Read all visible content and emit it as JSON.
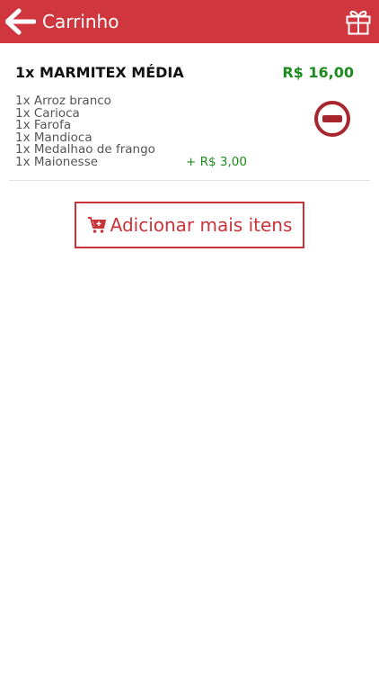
{
  "header": {
    "title": "Carrinho",
    "back_icon": "arrow-left-icon",
    "gift_icon": "gift-icon",
    "background_color": "#d0363d"
  },
  "cart": {
    "items": [
      {
        "title": "1x MARMITEX MÉDIA",
        "price": "R$ 16,00",
        "components": [
          {
            "label": "1x Arroz branco",
            "extra": ""
          },
          {
            "label": "1x Carioca",
            "extra": ""
          },
          {
            "label": "1x Farofa",
            "extra": ""
          },
          {
            "label": "1x Mandioca",
            "extra": ""
          },
          {
            "label": "1x Medalhao de frango",
            "extra": ""
          },
          {
            "label": "1x Maionesse",
            "extra": "+ R$ 3,00"
          }
        ],
        "remove_icon": "remove-circle-icon"
      }
    ]
  },
  "actions": {
    "add_more_label": "Adicionar mais itens",
    "add_more_icon": "cart-plus-icon",
    "accent_color": "#c9343a"
  },
  "colors": {
    "price_green": "#1e8a1e",
    "text_dark": "#111111",
    "text_muted": "#555555"
  }
}
